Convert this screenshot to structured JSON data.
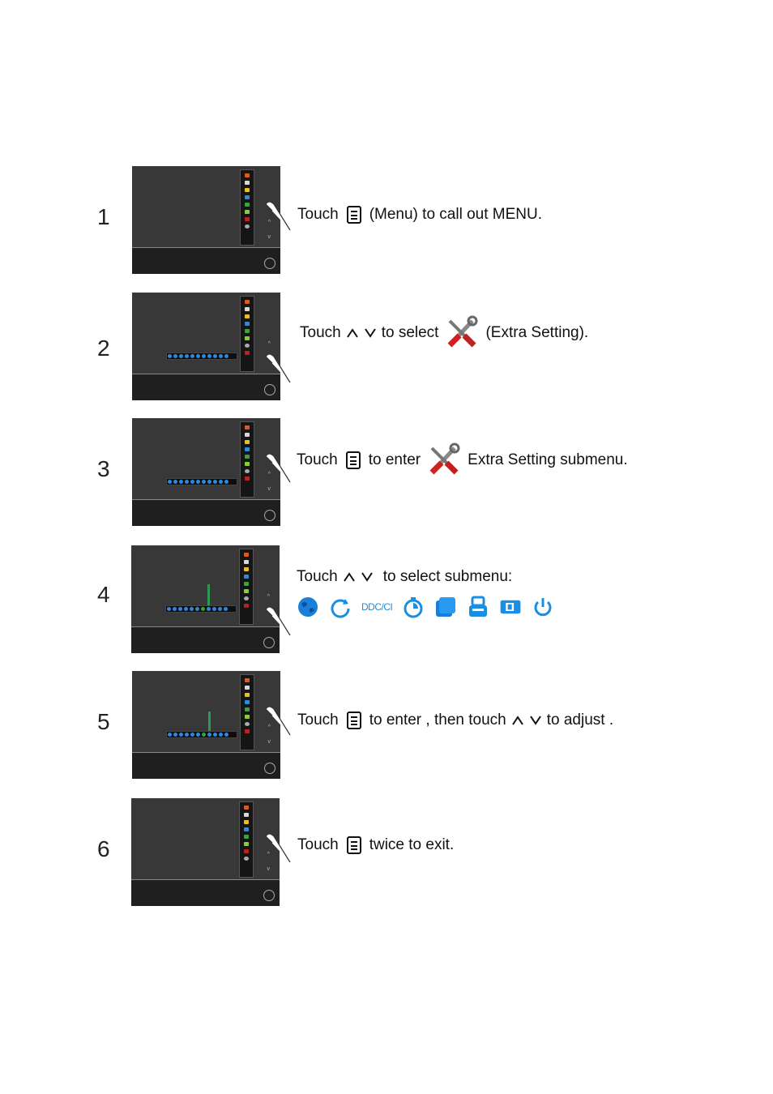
{
  "steps": [
    {
      "number": "1",
      "parts": [
        "Touch",
        "menu-icon",
        "(Menu) to  call out MENU."
      ]
    },
    {
      "number": "2",
      "parts": [
        "Touch",
        "up-icon",
        "down-icon",
        "to select",
        "extra-setting-icon",
        "(Extra Setting)."
      ]
    },
    {
      "number": "3",
      "parts": [
        "Touch",
        "menu-icon",
        "to enter",
        "extra-setting-icon",
        "Extra Setting  submenu."
      ]
    },
    {
      "number": "4",
      "parts": [
        "Touch",
        "up-icon",
        "down-icon",
        "to select submenu:"
      ]
    },
    {
      "number": "5",
      "parts": [
        "Touch",
        "menu-icon",
        "to enter ,  then touch",
        "up-icon",
        "down-icon",
        "to adjust ."
      ]
    },
    {
      "number": "6",
      "parts": [
        "Touch",
        "menu-icon",
        "twice to exit."
      ]
    }
  ],
  "text": {
    "s1_touch": "Touch",
    "s1_rest": "(Menu) to  call out MENU.",
    "s2_touch": "Touch",
    "s2_select": "to select",
    "s2_rest": "(Extra Setting).",
    "s3_touch": "Touch",
    "s3_enter": "to enter",
    "s3_rest": "Extra Setting  submenu.",
    "s4_touch": "Touch",
    "s4_rest": "to select submenu:",
    "s5_touch": "Touch",
    "s5_enter": "to enter ,  then touch",
    "s5_rest": "to adjust .",
    "s6_touch": "Touch",
    "s6_rest": "twice to exit."
  },
  "submenu_icons": [
    "language-globe-icon",
    "reset-icon",
    "DDC/CI",
    "timer-icon",
    "input-select-icon",
    "auto-config-icon",
    "image-ratio-icon",
    "power-icon"
  ],
  "ddc_label": "DDC/CI",
  "osd_colors": [
    "#e05a1a",
    "#d8d8d8",
    "#e8c020",
    "#2a8ae0",
    "#3aa040",
    "#8acf30",
    "#c02020",
    "#aaaaaa"
  ],
  "accent": "#1a8ee0"
}
